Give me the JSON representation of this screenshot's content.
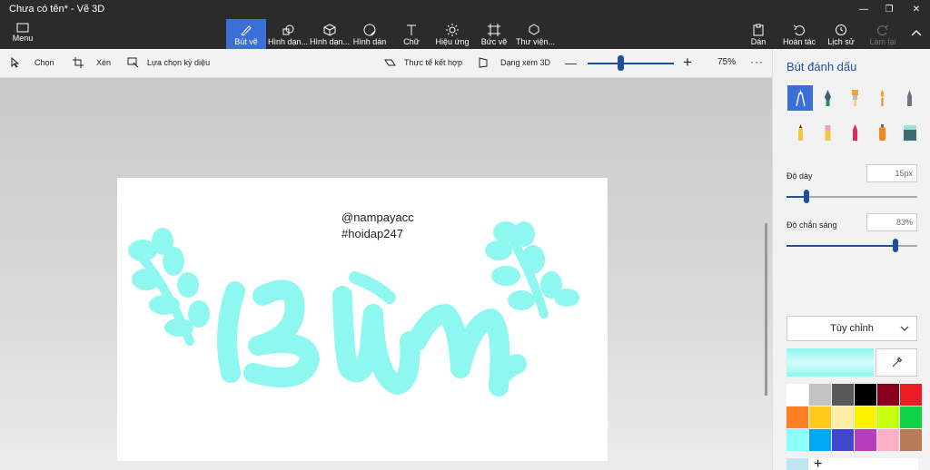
{
  "window": {
    "title": "Chưa có tên* - Vẽ 3D"
  },
  "toolbar": {
    "menu_label": "Menu",
    "tools": [
      {
        "label": "Bút vẽ"
      },
      {
        "label": "Hình dạn..."
      },
      {
        "label": "Hình dạn..."
      },
      {
        "label": "Hình dán"
      },
      {
        "label": "Chữ"
      },
      {
        "label": "Hiệu ứng"
      },
      {
        "label": "Bức vẽ"
      },
      {
        "label": "Thư viện..."
      }
    ],
    "right_tools": [
      {
        "label": "Dán"
      },
      {
        "label": "Hoàn tác"
      },
      {
        "label": "Lịch sử"
      },
      {
        "label": "Làm lại"
      }
    ]
  },
  "optionsbar": {
    "select": "Chọn",
    "crop": "Xén",
    "magic_select": "Lựa chọn kỳ diệu",
    "mixed_reality": "Thực tế kết hợp",
    "view3d": "Dạng xem 3D",
    "zoom_pct": "75%",
    "zoom_level": 0.38,
    "more": "···"
  },
  "canvas": {
    "watermark_line1": "@nampayacc",
    "watermark_line2": "#hoidap247",
    "art_color": "#8ef7f0"
  },
  "panel": {
    "title": "Bút đánh dấu",
    "thickness_label": "Độ dày",
    "thickness_value": "15px",
    "thickness_level": 0.15,
    "opacity_label": "Độ chắn sáng",
    "opacity_value": "83%",
    "opacity_level": 0.83,
    "color_dropdown": "Tùy chỉnh",
    "current_color": "#8ef7f0",
    "brushes": [
      "marker-icon",
      "calligraphy-pen-icon",
      "oil-brush-icon",
      "watercolor-icon",
      "pixel-pen-icon",
      "pencil-icon",
      "eraser-icon",
      "crayon-icon",
      "spray-can-icon",
      "fill-bucket-icon"
    ],
    "swatches": [
      "#ffffff",
      "#c3c3c3",
      "#585858",
      "#000000",
      "#88001b",
      "#ec1c24",
      "#ff7f27",
      "#ffca18",
      "#fdeca6",
      "#fff200",
      "#c4ff0e",
      "#0ed145",
      "#8cfffb",
      "#00a8f3",
      "#3f48cc",
      "#b83dba",
      "#ffaec8",
      "#b97a56"
    ],
    "add_label": "+"
  }
}
